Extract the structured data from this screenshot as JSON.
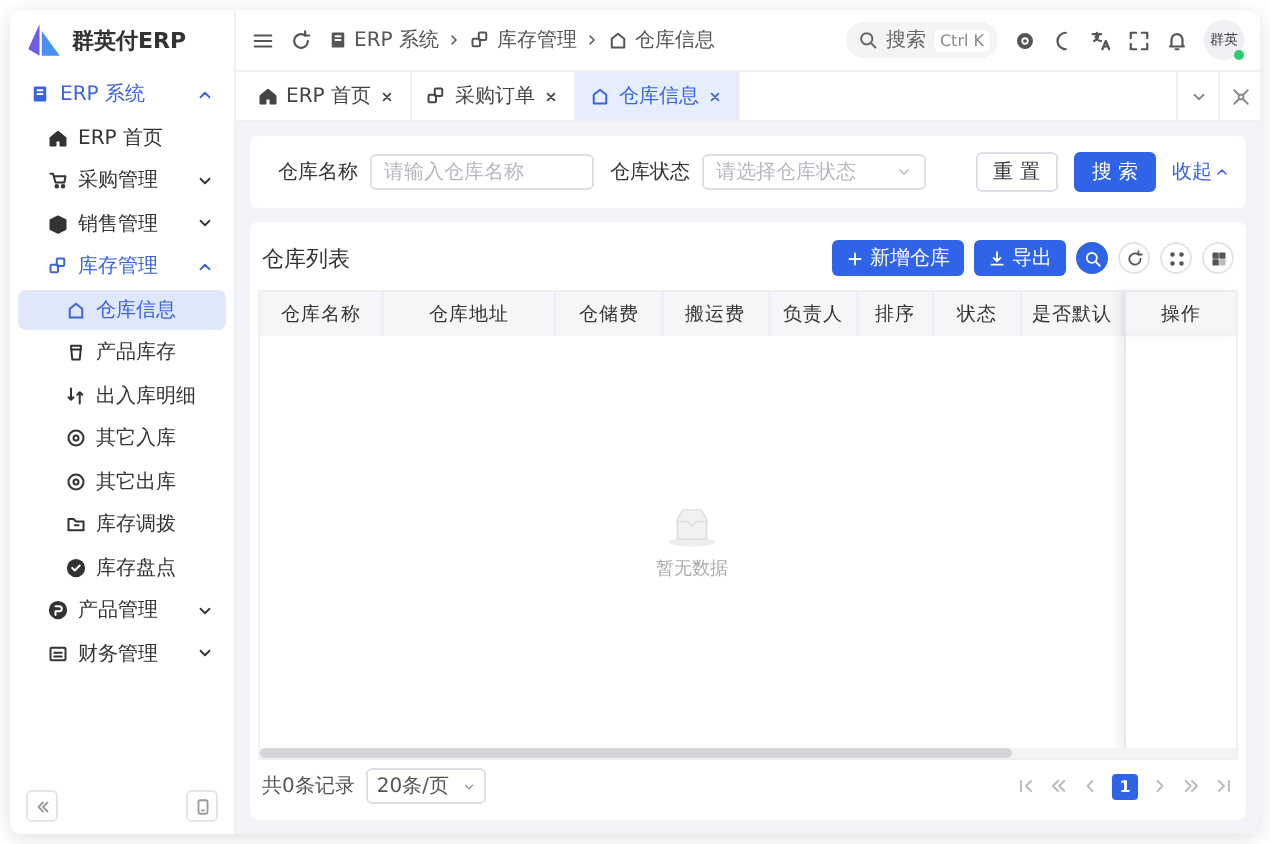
{
  "app": {
    "title": "群英付ERP"
  },
  "sidebar": {
    "items": [
      {
        "label": "ERP 系统",
        "expanded": true,
        "children": [
          {
            "label": "ERP 首页",
            "selected": false
          },
          {
            "label": "采购管理",
            "expanded": false
          },
          {
            "label": "销售管理",
            "expanded": false
          },
          {
            "label": "库存管理",
            "expanded": true,
            "children": [
              {
                "label": "仓库信息",
                "selected": true
              },
              {
                "label": "产品库存",
                "selected": false
              },
              {
                "label": "出入库明细",
                "selected": false
              },
              {
                "label": "其它入库",
                "selected": false
              },
              {
                "label": "其它出库",
                "selected": false
              },
              {
                "label": "库存调拨",
                "selected": false
              },
              {
                "label": "库存盘点",
                "selected": false
              }
            ]
          },
          {
            "label": "产品管理",
            "expanded": false
          },
          {
            "label": "财务管理",
            "expanded": false
          }
        ]
      }
    ]
  },
  "header": {
    "breadcrumb": [
      "ERP 系统",
      "库存管理",
      "仓库信息"
    ],
    "search": {
      "placeholder": "搜索",
      "shortcut": "Ctrl K"
    },
    "user": {
      "name": "群英",
      "online": true
    }
  },
  "tabs": [
    {
      "label": "ERP 首页",
      "selected": false
    },
    {
      "label": "采购订单",
      "selected": false
    },
    {
      "label": "仓库信息",
      "selected": true
    }
  ],
  "filters": [
    {
      "kind": "text",
      "label": "仓库名称",
      "placeholder": "请输入仓库名称"
    },
    {
      "kind": "select",
      "label": "仓库状态",
      "placeholder": "请选择仓库状态"
    }
  ],
  "filter_actions": {
    "reset": "重 置",
    "search": "搜 索",
    "collapse": "收起"
  },
  "table": {
    "title": "仓库列表",
    "actions": [
      {
        "kind": "add",
        "label": "新增仓库"
      },
      {
        "kind": "export",
        "label": "导出"
      }
    ],
    "columns": [
      "仓库名称",
      "仓库地址",
      "仓储费",
      "搬运费",
      "负责人",
      "排序",
      "状态",
      "是否默认",
      "操作"
    ],
    "empty_text": "暂无数据"
  },
  "footer": {
    "total": "共0条记录",
    "page_size": "20条/页",
    "pages": [
      {
        "label": "1",
        "selected": true
      }
    ]
  }
}
